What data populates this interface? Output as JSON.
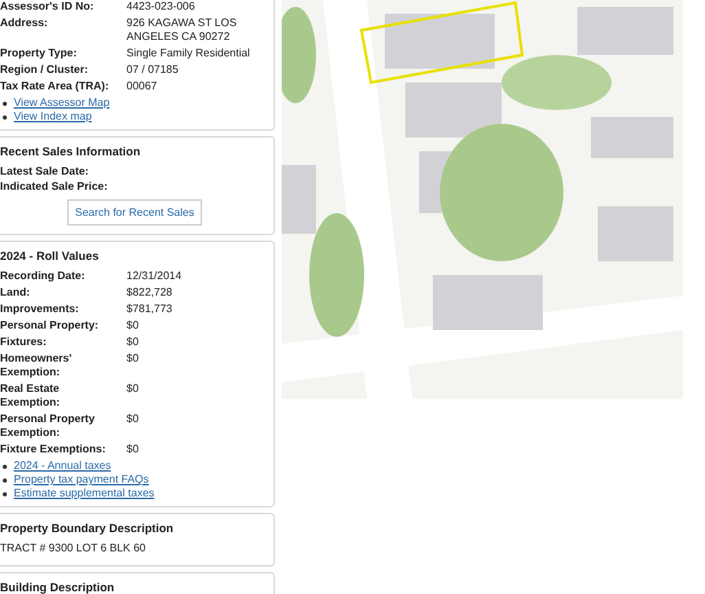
{
  "parcel": {
    "fields": [
      {
        "label": "Assessor's ID No:",
        "value": "4423-023-006"
      },
      {
        "label": "Address:",
        "value": "926 KAGAWA ST LOS ANGELES CA 90272"
      },
      {
        "label": "Property Type:",
        "value": "Single Family Residential"
      },
      {
        "label": "Region / Cluster:",
        "value": "07 / 07185"
      },
      {
        "label": "Tax Rate Area (TRA):",
        "value": "00067"
      }
    ],
    "links": [
      "View Assessor Map",
      "View Index map"
    ]
  },
  "recent_sales": {
    "title": "Recent Sales Information",
    "fields": [
      {
        "label": "Latest Sale Date:"
      },
      {
        "label": "Indicated Sale Price:"
      }
    ],
    "button": "Search for Recent Sales"
  },
  "roll_values": {
    "title": "2024 - Roll Values",
    "fields": [
      {
        "label": "Recording Date:",
        "value": "12/31/2014"
      },
      {
        "label": "Land:",
        "value": "$822,728"
      },
      {
        "label": "Improvements:",
        "value": "$781,773"
      },
      {
        "label": "Personal Property:",
        "value": "$0"
      },
      {
        "label": "Fixtures:",
        "value": "$0"
      },
      {
        "label": "Homeowners' Exemption:",
        "value": "$0"
      },
      {
        "label": "Real Estate Exemption:",
        "value": "$0"
      },
      {
        "label": "Personal Property Exemption:",
        "value": "$0"
      },
      {
        "label": "Fixture Exemptions:",
        "value": "$0"
      }
    ],
    "links": [
      "2024 - Annual taxes",
      "Property tax payment FAQs",
      "Estimate supplemental taxes"
    ]
  },
  "boundary": {
    "title": "Property Boundary Description",
    "text": "TRACT # 9300 LOT 6 BLK 60"
  },
  "building": {
    "title": "Building Description"
  }
}
